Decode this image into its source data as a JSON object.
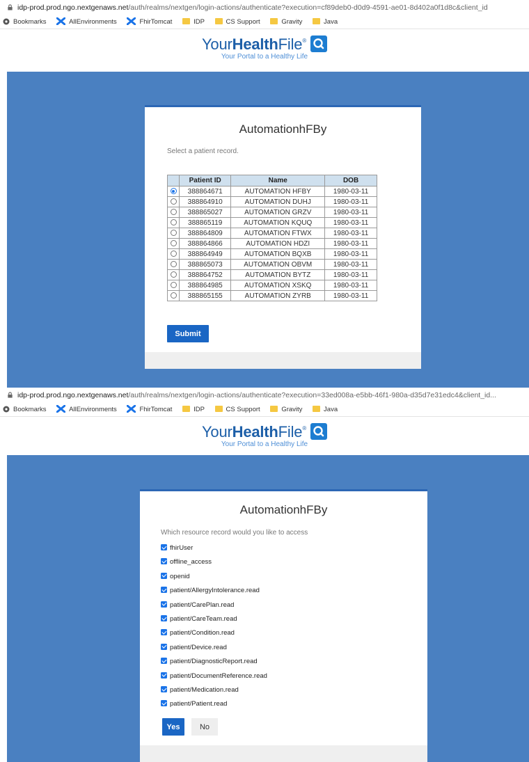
{
  "shot1": {
    "url": {
      "host": "idp-prod.prod.ngo.nextgenaws.net",
      "path": "/auth/realms/nextgen/login-actions/authenticate?execution=cf89deb0-d0d9-4591-ae01-8d402a0f1d8c&client_id"
    },
    "bookmarks": [
      "Bookmarks",
      "AllEnvironments",
      "FhirTomcat",
      "IDP",
      "CS Support",
      "Gravity",
      "Java"
    ],
    "brand": {
      "name_light": "Your",
      "name_bold": "Health",
      "name_tail": "File",
      "reg": "®",
      "tagline": "Your Portal to a Healthy Life"
    },
    "card_title": "AutomationhFBy",
    "prompt": "Select a patient record.",
    "table": {
      "headers": [
        "Patient ID",
        "Name",
        "DOB"
      ],
      "selected_index": 0,
      "rows": [
        [
          "388864671",
          "AUTOMATION HFBY",
          "1980-03-11"
        ],
        [
          "388864910",
          "AUTOMATION DUHJ",
          "1980-03-11"
        ],
        [
          "388865027",
          "AUTOMATION GRZV",
          "1980-03-11"
        ],
        [
          "388865119",
          "AUTOMATION KQUQ",
          "1980-03-11"
        ],
        [
          "388864809",
          "AUTOMATION FTWX",
          "1980-03-11"
        ],
        [
          "388864866",
          "AUTOMATION HDZI",
          "1980-03-11"
        ],
        [
          "388864949",
          "AUTOMATION BQXB",
          "1980-03-11"
        ],
        [
          "388865073",
          "AUTOMATION OBVM",
          "1980-03-11"
        ],
        [
          "388864752",
          "AUTOMATION BYTZ",
          "1980-03-11"
        ],
        [
          "388864985",
          "AUTOMATION XSKQ",
          "1980-03-11"
        ],
        [
          "388865155",
          "AUTOMATION ZYRB",
          "1980-03-11"
        ]
      ]
    },
    "submit_label": "Submit"
  },
  "shot2": {
    "url": {
      "host": "idp-prod.prod.ngo.nextgenaws.net",
      "path": "/auth/realms/nextgen/login-actions/authenticate?execution=33ed008a-e5bb-46f1-980a-d35d7e31edc4&client_id..."
    },
    "bookmarks": [
      "Bookmarks",
      "AllEnvironments",
      "FhirTomcat",
      "IDP",
      "CS Support",
      "Gravity",
      "Java"
    ],
    "brand": {
      "name_light": "Your",
      "name_bold": "Health",
      "name_tail": "File",
      "reg": "®",
      "tagline": "Your Portal to a Healthy Life"
    },
    "card_title": "AutomationhFBy",
    "prompt": "Which resource record would you like to access",
    "scopes": [
      "fhirUser",
      "offline_access",
      "openid",
      "patient/AllergyIntolerance.read",
      "patient/CarePlan.read",
      "patient/CareTeam.read",
      "patient/Condition.read",
      "patient/Device.read",
      "patient/DiagnosticReport.read",
      "patient/DocumentReference.read",
      "patient/Medication.read",
      "patient/Patient.read"
    ],
    "yes_label": "Yes",
    "no_label": "No"
  },
  "colors": {
    "background_blue": "#4a80c1",
    "brand_blue": "#1d5fa8",
    "button_blue": "#1a66c4",
    "table_header": "#cfe0ee"
  },
  "icons": {
    "lock": "lock-icon",
    "bookmarks": "bookmarks-icon",
    "environment": "x-logo-icon",
    "folder": "folder-icon",
    "search": "search-icon"
  }
}
